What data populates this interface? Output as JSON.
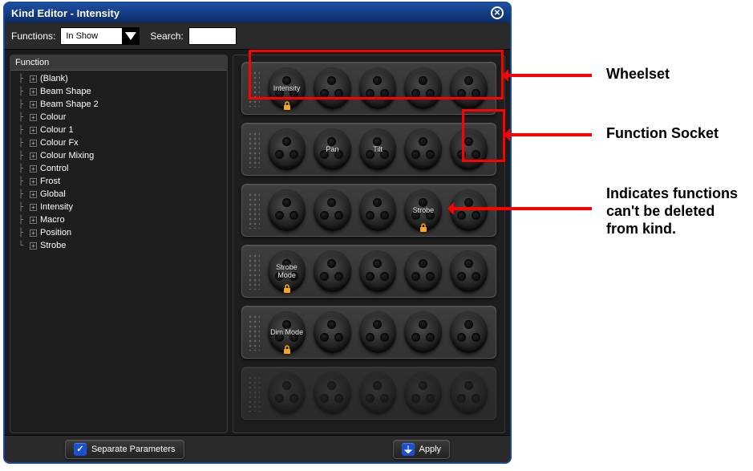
{
  "window": {
    "title": "Kind Editor - Intensity"
  },
  "toolbar": {
    "functions_label": "Functions:",
    "functions_value": "In Show",
    "search_label": "Search:",
    "search_value": ""
  },
  "tree": {
    "header": "Function",
    "items": [
      "(Blank)",
      "Beam Shape",
      "Beam Shape 2",
      "Colour",
      "Colour 1",
      "Colour Fx",
      "Colour Mixing",
      "Control",
      "Frost",
      "Global",
      "Intensity",
      "Macro",
      "Position",
      "Strobe"
    ]
  },
  "wheelsets": [
    {
      "ghost": false,
      "sockets": [
        {
          "label": "Intensity",
          "locked": true
        },
        {
          "label": ""
        },
        {
          "label": ""
        },
        {
          "label": ""
        },
        {
          "label": ""
        }
      ]
    },
    {
      "ghost": false,
      "sockets": [
        {
          "label": ""
        },
        {
          "label": "Pan"
        },
        {
          "label": "Tilt"
        },
        {
          "label": ""
        },
        {
          "label": ""
        }
      ]
    },
    {
      "ghost": false,
      "sockets": [
        {
          "label": ""
        },
        {
          "label": ""
        },
        {
          "label": ""
        },
        {
          "label": "Strobe",
          "locked": true
        },
        {
          "label": ""
        }
      ]
    },
    {
      "ghost": false,
      "sockets": [
        {
          "label": "Strobe Mode",
          "locked": true
        },
        {
          "label": ""
        },
        {
          "label": ""
        },
        {
          "label": ""
        },
        {
          "label": ""
        }
      ]
    },
    {
      "ghost": false,
      "sockets": [
        {
          "label": "Dim Mode",
          "locked": true
        },
        {
          "label": ""
        },
        {
          "label": ""
        },
        {
          "label": ""
        },
        {
          "label": ""
        }
      ]
    },
    {
      "ghost": true,
      "sockets": [
        {
          "label": ""
        },
        {
          "label": ""
        },
        {
          "label": ""
        },
        {
          "label": ""
        },
        {
          "label": ""
        }
      ]
    }
  ],
  "bottombar": {
    "separate_label": "Separate Parameters",
    "separate_checked": true,
    "apply_label": "Apply"
  },
  "annotations": {
    "wheelset": "Wheelset",
    "socket": "Function Socket",
    "lock": "Indicates functions can't be deleted from kind."
  }
}
